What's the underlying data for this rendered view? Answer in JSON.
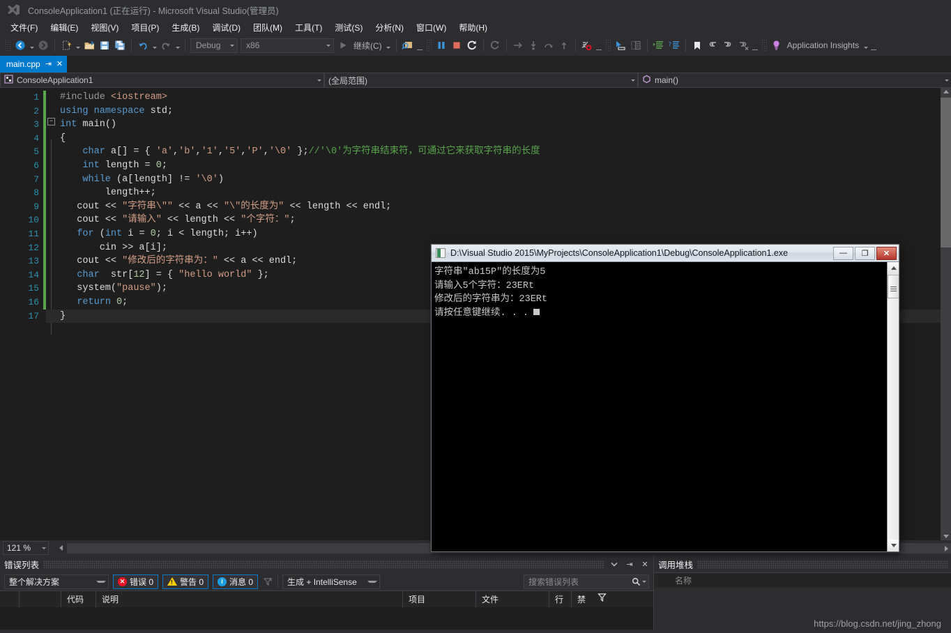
{
  "titlebar": {
    "logo_icon": "visual-studio-logo",
    "title": "ConsoleApplication1 (正在运行) - Microsoft Visual Studio(管理员)"
  },
  "menubar": {
    "items": [
      {
        "label": "文件(F)"
      },
      {
        "label": "编辑(E)"
      },
      {
        "label": "视图(V)"
      },
      {
        "label": "项目(P)"
      },
      {
        "label": "生成(B)"
      },
      {
        "label": "调试(D)"
      },
      {
        "label": "团队(M)"
      },
      {
        "label": "工具(T)"
      },
      {
        "label": "测试(S)"
      },
      {
        "label": "分析(N)"
      },
      {
        "label": "窗口(W)"
      },
      {
        "label": "帮助(H)"
      }
    ]
  },
  "toolbar": {
    "nav_back_icon": "navigate-back-icon",
    "nav_forward_icon": "navigate-forward-icon",
    "new_item_icon": "new-item-icon",
    "open_file_icon": "open-file-icon",
    "save_icon": "save-icon",
    "save_all_icon": "save-all-icon",
    "undo_icon": "undo-icon",
    "redo_icon": "redo-icon",
    "config_value": "Debug",
    "platform_value": "x86",
    "continue_label": "继续(C)",
    "continue_icon": "play-icon",
    "find_icon": "find-in-files-icon",
    "pause_icon": "pause-icon",
    "stop_icon": "stop-icon",
    "restart_icon": "restart-icon",
    "hot_reload_icon": "hot-reload-icon",
    "step_over_icon": "step-over-icon",
    "step_into_icon": "step-into-icon",
    "step_out_arc_icon": "step-out-arc-icon",
    "step_out_icon": "step-out-icon",
    "breakpoints_icon": "breakpoints-icon",
    "cursor_select_icon": "pointer-select-icon",
    "compare_icon": "compare-icon",
    "indent_icon": "indent-icon",
    "comment_icon": "comment-icon",
    "bookmark_icon": "bookmark-icon",
    "prev_bookmark_icon": "previous-bookmark-icon",
    "next_bookmark_icon": "next-bookmark-icon",
    "clear_bookmark_icon": "clear-bookmark-icon",
    "insights_label": "Application Insights",
    "insights_icon": "lightbulb-icon"
  },
  "tabstrip": {
    "tab_label": "main.cpp",
    "pin_icon": "pin-icon",
    "close_icon": "close-icon"
  },
  "navbar": {
    "project_icon": "project-icon",
    "project": "ConsoleApplication1",
    "scope": "(全局范围)",
    "member_icon": "method-cube-icon",
    "member": "main()"
  },
  "editor": {
    "zoom": "121 %",
    "lines": [
      {
        "n": "1",
        "changed": true,
        "cur": false,
        "html": "<span class='pp'>#include </span><span class='inc'>&lt;iostream&gt;</span>"
      },
      {
        "n": "2",
        "changed": true,
        "cur": false,
        "html": "<span class='kw'>using</span> <span class='kw'>namespace</span> <span class='id'>std</span>;"
      },
      {
        "n": "3",
        "changed": true,
        "cur": false,
        "html": "<span class='kw'>int</span> <span class='id'>main</span>()",
        "outline": true
      },
      {
        "n": "4",
        "changed": true,
        "cur": false,
        "html": "{"
      },
      {
        "n": "5",
        "changed": true,
        "cur": false,
        "html": "    <span class='kw'>char</span> a[] = { <span class='str'>'a'</span>,<span class='str'>'b'</span>,<span class='str'>'1'</span>,<span class='str'>'5'</span>,<span class='str'>'P'</span>,<span class='str'>'\\0'</span> };<span class='cmt'>//'\\0'为字符串结束符，可通过它来获取字符串的长度</span>"
      },
      {
        "n": "6",
        "changed": true,
        "cur": false,
        "html": "    <span class='kw'>int</span> length = <span class='num'>0</span>;"
      },
      {
        "n": "7",
        "changed": true,
        "cur": false,
        "html": "    <span class='kw'>while</span> (a[length] != <span class='str'>'\\0'</span>)"
      },
      {
        "n": "8",
        "changed": true,
        "cur": false,
        "html": "        length++;"
      },
      {
        "n": "9",
        "changed": true,
        "cur": false,
        "html": "   cout &lt;&lt; <span class='str'>\"字符串\\\"\"</span> &lt;&lt; a &lt;&lt; <span class='str'>\"\\\"的长度为\"</span> &lt;&lt; length &lt;&lt; endl;"
      },
      {
        "n": "10",
        "changed": true,
        "cur": false,
        "html": "   cout &lt;&lt; <span class='str'>\"请输入\"</span> &lt;&lt; length &lt;&lt; <span class='str'>\"个字符：\"</span>;"
      },
      {
        "n": "11",
        "changed": true,
        "cur": false,
        "html": "   <span class='kw'>for</span> (<span class='kw'>int</span> i = <span class='num'>0</span>; i &lt; length; i++)"
      },
      {
        "n": "12",
        "changed": true,
        "cur": false,
        "html": "       cin &gt;&gt; a[i];"
      },
      {
        "n": "13",
        "changed": true,
        "cur": false,
        "html": "   cout &lt;&lt; <span class='str'>\"修改后的字符串为：\"</span> &lt;&lt; a &lt;&lt; endl;"
      },
      {
        "n": "14",
        "changed": true,
        "cur": false,
        "html": "   <span class='kw'>char</span>  str[<span class='num'>12</span>] = { <span class='str'>\"hello world\"</span> };"
      },
      {
        "n": "15",
        "changed": true,
        "cur": false,
        "html": "   system(<span class='str'>\"pause\"</span>);"
      },
      {
        "n": "16",
        "changed": true,
        "cur": false,
        "html": "   <span class='kw'>return</span> <span class='num'>0</span>;"
      },
      {
        "n": "17",
        "changed": false,
        "cur": true,
        "html": "}"
      }
    ]
  },
  "console": {
    "icon": "console-window-icon",
    "title": "D:\\Visual Studio 2015\\MyProjects\\ConsoleApplication1\\Debug\\ConsoleApplication1.exe",
    "minimize_label": "—",
    "maximize_label": "❐",
    "close_label": "✕",
    "output": [
      "字符串\"ab15P\"的长度为5",
      "请输入5个字符：23ERt",
      "修改后的字符串为：23ERt",
      "请按任意键继续. . ."
    ]
  },
  "error_list": {
    "title": "错误列表",
    "dropdown_icon": "chevron-down-icon",
    "pin_icon": "pin-icon",
    "close_icon": "close-icon",
    "scope_value": "整个解决方案",
    "errors_label": "错误 0",
    "warnings_label": "警告 0",
    "messages_label": "消息 0",
    "filter_icon": "clear-filter-icon",
    "build_filter_value": "生成 + IntelliSense",
    "search_placeholder": "搜索错误列表",
    "search_icon": "search-icon",
    "columns": [
      "",
      "",
      "代码",
      "说明",
      "项目",
      "文件",
      "行",
      "禁"
    ],
    "funnel_icon": "filter-funnel-icon",
    "rows": []
  },
  "call_stack": {
    "title": "调用堆栈",
    "column_name": "名称",
    "rows": []
  },
  "watermark": {
    "text": "https://blog.csdn.net/jing_zhong"
  }
}
